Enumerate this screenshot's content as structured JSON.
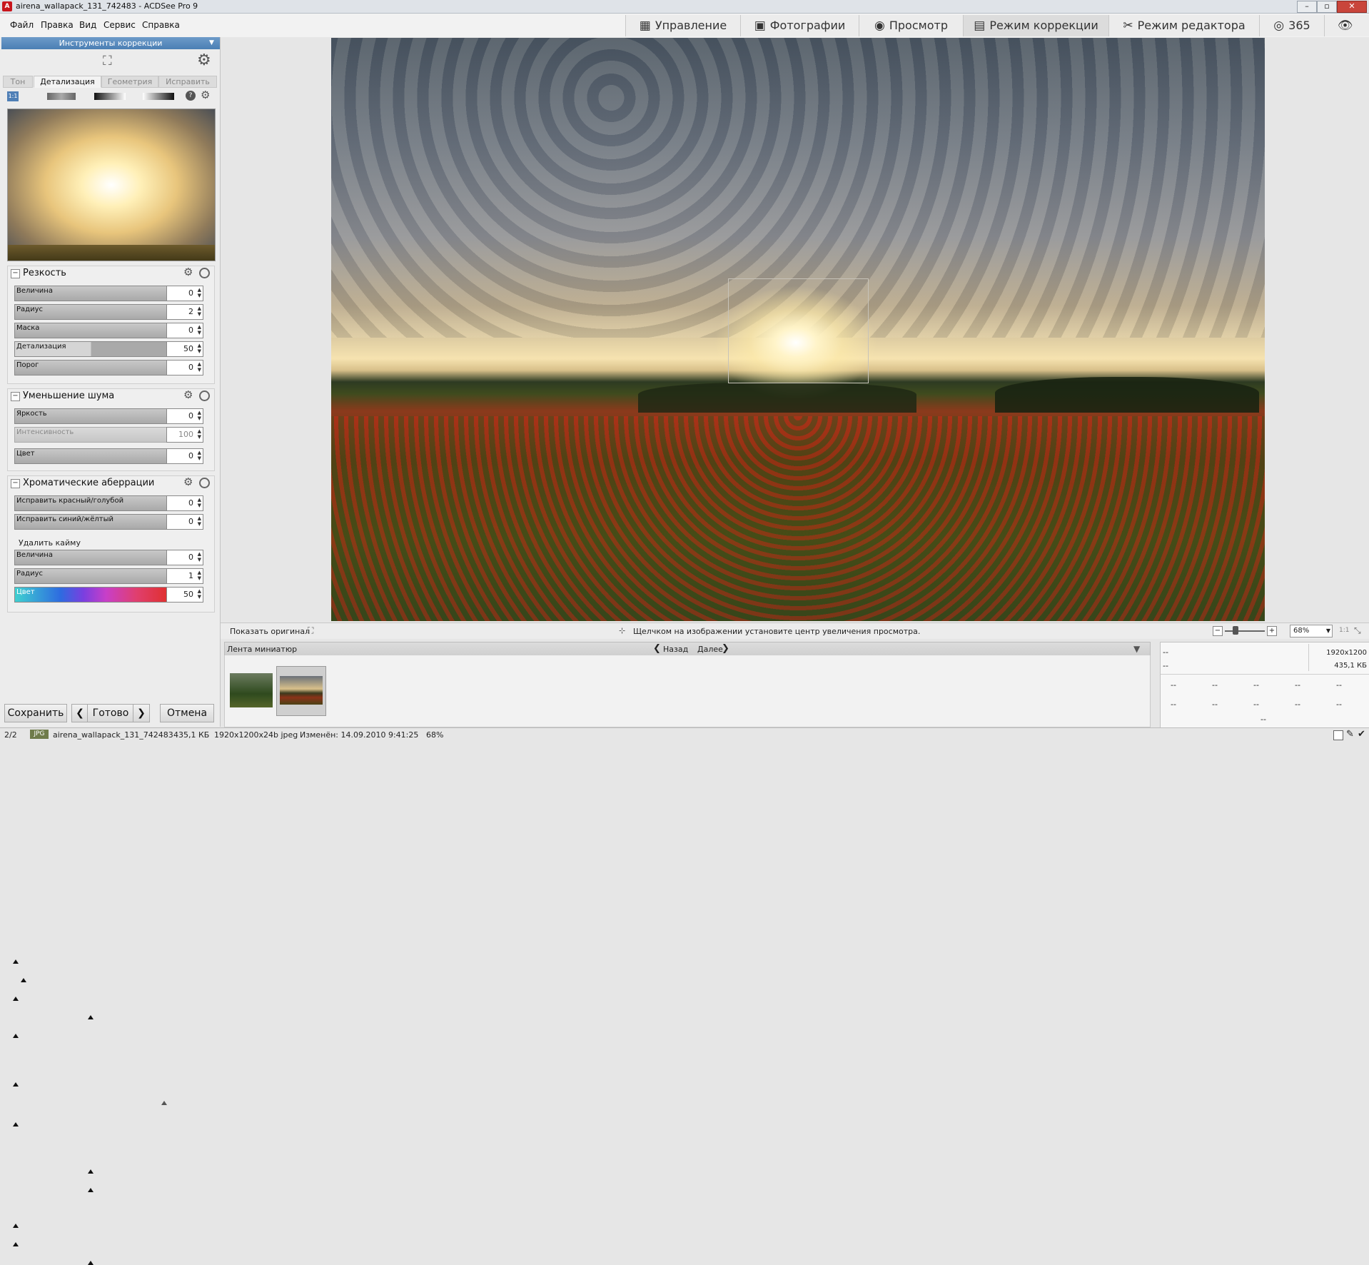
{
  "window": {
    "title": "airena_wallapack_131_742483 - ACDSee Pro 9",
    "app_icon": "acdsee-icon"
  },
  "menu": [
    "Файл",
    "Правка",
    "Вид",
    "Сервис",
    "Справка"
  ],
  "modes": [
    {
      "label": "Управление",
      "icon": "grid-icon"
    },
    {
      "label": "Фотографии",
      "icon": "photos-icon"
    },
    {
      "label": "Просмотр",
      "icon": "eye-icon"
    },
    {
      "label": "Режим коррекции",
      "icon": "develop-icon",
      "active": true
    },
    {
      "label": "Режим редактора",
      "icon": "edit-tools-icon"
    },
    {
      "label": "365",
      "icon": "cloud-365-icon"
    }
  ],
  "panel": {
    "header": "Инструменты коррекции",
    "tabs": [
      "Тон",
      "Детализация",
      "Геометрия",
      "Исправить"
    ],
    "active_tab": "Детализация",
    "zoom_badge": "1:1",
    "help": "?",
    "sharpness": {
      "title": "Резкость",
      "sliders": [
        {
          "label": "Величина",
          "value": "0",
          "fraction": 0.0
        },
        {
          "label": "Радиус",
          "value": "2",
          "fraction": 0.05
        },
        {
          "label": "Маска",
          "value": "0",
          "fraction": 0.0
        },
        {
          "label": "Детализация",
          "value": "50",
          "fraction": 0.5
        },
        {
          "label": "Порог",
          "value": "0",
          "fraction": 0.0
        }
      ]
    },
    "noise": {
      "title": "Уменьшение шума",
      "sliders": [
        {
          "label": "Яркость",
          "value": "0",
          "fraction": 0.0
        },
        {
          "label": "Интенсивность",
          "value": "100",
          "fraction": 1.0,
          "disabled": true
        },
        {
          "label": "Цвет",
          "value": "0",
          "fraction": 0.0
        }
      ]
    },
    "chroma": {
      "title": "Хроматические аберрации",
      "sliders": [
        {
          "label": "Исправить красный/голубой",
          "value": "0",
          "fraction": 0.5
        },
        {
          "label": "Исправить синий/жёлтый",
          "value": "0",
          "fraction": 0.5
        }
      ],
      "fringe_label": "Удалить кайму",
      "fringe_sliders": [
        {
          "label": "Величина",
          "value": "0",
          "fraction": 0.0
        },
        {
          "label": "Радиус",
          "value": "1",
          "fraction": 0.0
        },
        {
          "label": "Цвет",
          "value": "50",
          "fraction": 0.5
        }
      ]
    },
    "buttons": {
      "save": "Сохранить",
      "done": "Готово",
      "cancel": "Отмена"
    }
  },
  "viewer": {
    "show_original": "Показать оригинал",
    "hint": "Щелчком на изображении установите центр увеличения просмотра.",
    "zoom": "68%",
    "one_to_one": "1:1"
  },
  "filmstrip": {
    "title": "Лента миниатюр",
    "back": "Назад",
    "next": "Далее"
  },
  "info": {
    "top_left_1": "--",
    "top_left_2": "--",
    "dims": "1920x1200",
    "size": "435,1 КБ",
    "row1": [
      "--",
      "--",
      "--",
      "--",
      "--"
    ],
    "row2": [
      "--",
      "--",
      "--",
      "--",
      "--"
    ],
    "bottom": "--"
  },
  "status": {
    "count": "2/2",
    "format_badge": "JPG",
    "filename": "airena_wallapack_131_742483",
    "size": "435,1 КБ",
    "dims": "1920x1200x24b jpeg",
    "modified": "Изменён: 14.09.2010 9:41:25",
    "zoom": "68%"
  }
}
